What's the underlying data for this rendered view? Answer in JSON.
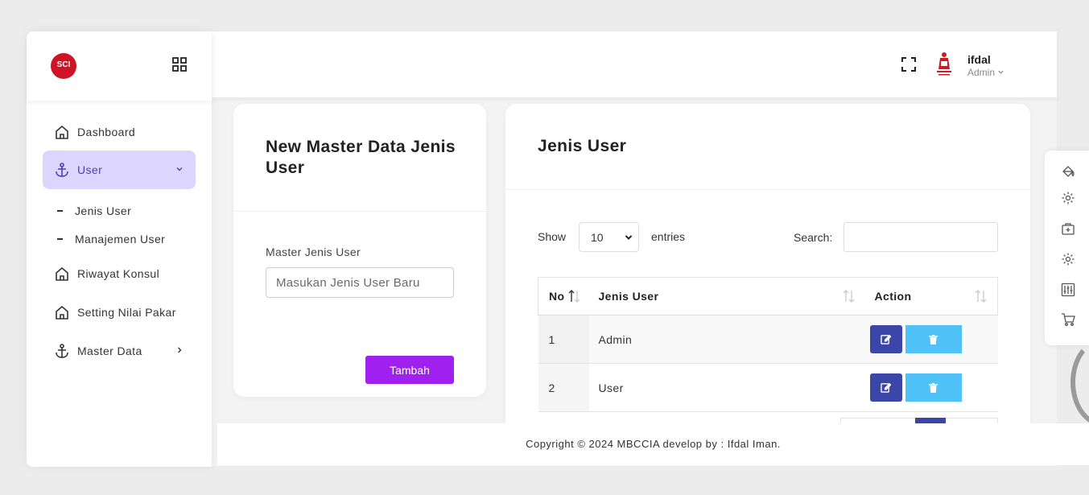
{
  "brand": {
    "logo_text": "SCI"
  },
  "topbar": {
    "user_name": "ifdal",
    "user_role": "Admin"
  },
  "sidebar": {
    "items": [
      {
        "label": "Dashboard"
      },
      {
        "label": "User"
      },
      {
        "label": "Riwayat Konsul"
      },
      {
        "label": "Setting Nilai Pakar"
      },
      {
        "label": "Master Data"
      }
    ],
    "subitems": [
      {
        "label": "Jenis User"
      },
      {
        "label": "Manajemen User"
      }
    ]
  },
  "form": {
    "title": "New Master Data Jenis User",
    "field_label": "Master Jenis User",
    "placeholder": "Masukan Jenis User Baru",
    "submit_label": "Tambah"
  },
  "list": {
    "title": "Jenis User",
    "show_label": "Show",
    "page_length": "10",
    "entries_label": "entries",
    "search_label": "Search:",
    "columns": [
      "No",
      "Jenis User",
      "Action"
    ],
    "rows": [
      {
        "no": "1",
        "jenis": "Admin"
      },
      {
        "no": "2",
        "jenis": "User"
      }
    ]
  },
  "footer": {
    "text": "Copyright © 2024 MBCCIA develop by : Ifdal Iman."
  },
  "colors": {
    "accent_purple": "#a020f0",
    "active_nav_bg": "#dcd5fd",
    "edit_button": "#3b46a8",
    "delete_button": "#4fc3f7",
    "logo_red": "#d01225"
  },
  "icons": {
    "sidebar": [
      "home-icon",
      "anchor-icon",
      "home-icon",
      "home-icon",
      "anchor-icon"
    ],
    "right_panel": [
      "paint-bucket-icon",
      "gear-icon",
      "medical-case-icon",
      "gear-icon",
      "sliders-icon",
      "cart-icon"
    ]
  }
}
